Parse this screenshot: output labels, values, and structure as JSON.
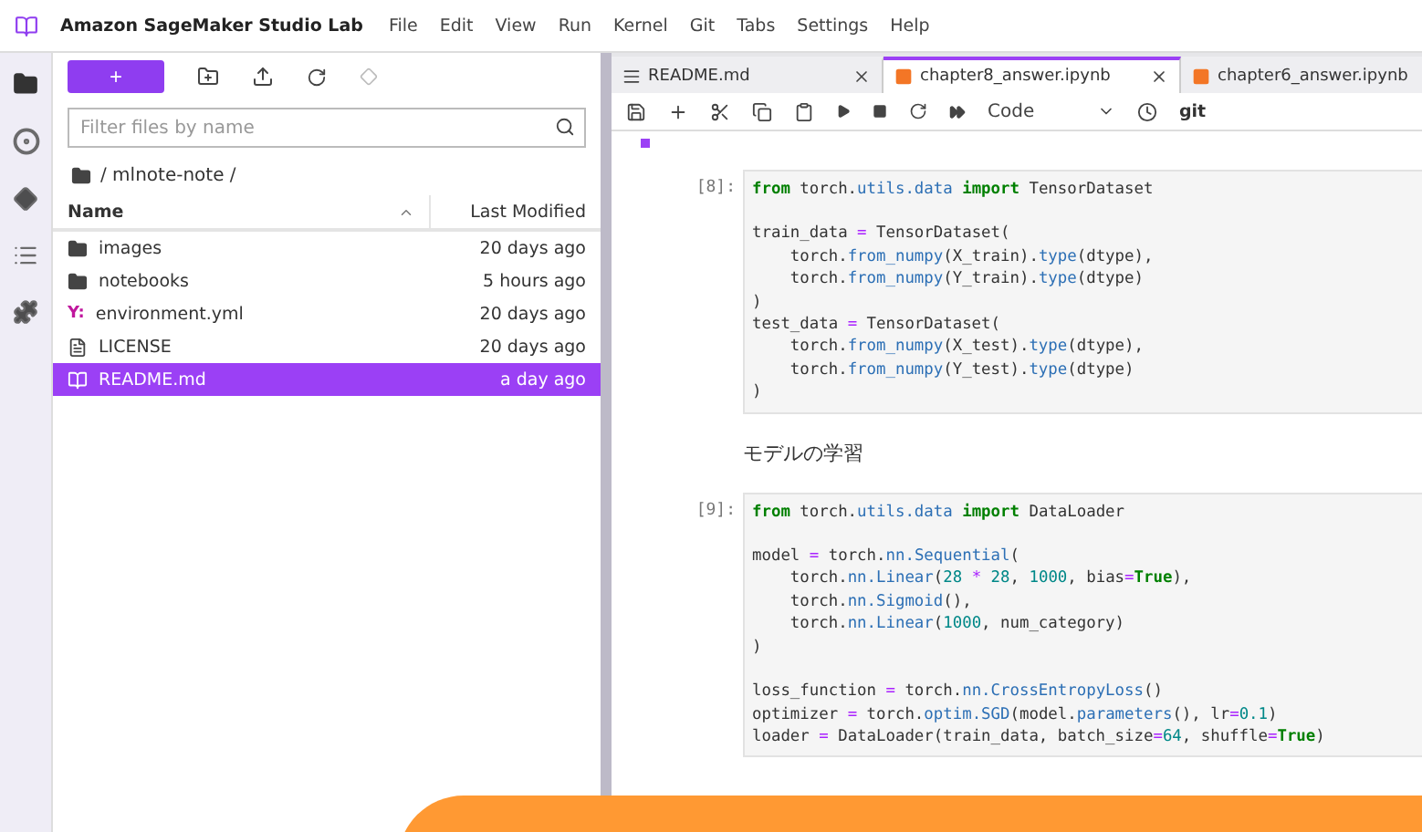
{
  "app_title": "Amazon SageMaker Studio Lab",
  "menu": [
    "File",
    "Edit",
    "View",
    "Run",
    "Kernel",
    "Git",
    "Tabs",
    "Settings",
    "Help"
  ],
  "activity_bar": [
    {
      "kind": "folder",
      "selected": true
    },
    {
      "kind": "running",
      "selected": false
    },
    {
      "kind": "git",
      "selected": false
    },
    {
      "kind": "toc",
      "selected": false
    },
    {
      "kind": "extensions",
      "selected": false
    }
  ],
  "file_browser": {
    "new_button": "+",
    "search": {
      "placeholder": "Filter files by name"
    },
    "path": "/ mlnote-note /",
    "columns": [
      "Name",
      "Last Modified"
    ],
    "files": [
      {
        "kind": "folder",
        "name": "images",
        "modified": "20 days ago",
        "selected": false
      },
      {
        "kind": "folder",
        "name": "notebooks",
        "modified": "5 hours ago",
        "selected": false
      },
      {
        "kind": "yaml",
        "badge": "Y:",
        "name": "environment.yml",
        "modified": "20 days ago",
        "selected": false
      },
      {
        "kind": "file",
        "name": "LICENSE",
        "modified": "20 days ago",
        "selected": false
      },
      {
        "kind": "markdown",
        "name": "README.md",
        "modified": "a day ago",
        "selected": true
      }
    ]
  },
  "tabs": [
    {
      "kind": "markdown",
      "label": "README.md",
      "selected": false
    },
    {
      "kind": "notebook",
      "label": "chapter8_answer.ipynb",
      "selected": true
    },
    {
      "kind": "notebook",
      "label": "chapter6_answer.ipynb",
      "selected": false
    }
  ],
  "toolbar": {
    "cell_type": "Code",
    "git": "git"
  },
  "cells": [
    {
      "kind": "code",
      "prompt": "[8]:",
      "blocks": [
        [
          [
            {
              "kind": "keyword",
              "text": "from"
            },
            {
              "kind": "plain",
              "text": " torch."
            },
            {
              "kind": "name",
              "text": "utils.data"
            },
            {
              "kind": "keyword",
              "text": " import"
            },
            {
              "kind": "plain",
              "text": " TensorDataset"
            }
          ]
        ],
        [
          [
            {
              "kind": "plain",
              "text": "train_data "
            },
            {
              "kind": "operator",
              "text": "="
            },
            {
              "kind": "plain",
              "text": " TensorDataset("
            }
          ],
          [
            {
              "kind": "plain",
              "text": "    torch."
            },
            {
              "kind": "name",
              "text": "from_numpy"
            },
            {
              "kind": "plain",
              "text": "(X_train)."
            },
            {
              "kind": "name",
              "text": "type"
            },
            {
              "kind": "plain",
              "text": "(dtype),"
            }
          ],
          [
            {
              "kind": "plain",
              "text": "    torch."
            },
            {
              "kind": "name",
              "text": "from_numpy"
            },
            {
              "kind": "plain",
              "text": "(Y_train)."
            },
            {
              "kind": "name",
              "text": "type"
            },
            {
              "kind": "plain",
              "text": "(dtype)"
            }
          ],
          [
            {
              "kind": "plain",
              "text": ")"
            }
          ],
          [
            {
              "kind": "plain",
              "text": "test_data "
            },
            {
              "kind": "operator",
              "text": "="
            },
            {
              "kind": "plain",
              "text": " TensorDataset("
            }
          ],
          [
            {
              "kind": "plain",
              "text": "    torch."
            },
            {
              "kind": "name",
              "text": "from_numpy"
            },
            {
              "kind": "plain",
              "text": "(X_test)."
            },
            {
              "kind": "name",
              "text": "type"
            },
            {
              "kind": "plain",
              "text": "(dtype),"
            }
          ],
          [
            {
              "kind": "plain",
              "text": "    torch."
            },
            {
              "kind": "name",
              "text": "from_numpy"
            },
            {
              "kind": "plain",
              "text": "(Y_test)."
            },
            {
              "kind": "name",
              "text": "type"
            },
            {
              "kind": "plain",
              "text": "(dtype)"
            }
          ],
          [
            {
              "kind": "plain",
              "text": ")"
            }
          ]
        ]
      ]
    },
    {
      "kind": "markdown",
      "text": "モデルの学習"
    },
    {
      "kind": "code",
      "prompt": "[9]:",
      "blocks": [
        [
          [
            {
              "kind": "keyword",
              "text": "from"
            },
            {
              "kind": "plain",
              "text": " torch."
            },
            {
              "kind": "name",
              "text": "utils.data"
            },
            {
              "kind": "keyword",
              "text": " import"
            },
            {
              "kind": "plain",
              "text": " DataLoader"
            }
          ]
        ],
        [
          [
            {
              "kind": "plain",
              "text": "model "
            },
            {
              "kind": "operator",
              "text": "="
            },
            {
              "kind": "plain",
              "text": " torch."
            },
            {
              "kind": "name",
              "text": "nn.Sequential"
            },
            {
              "kind": "plain",
              "text": "("
            }
          ],
          [
            {
              "kind": "plain",
              "text": "    torch."
            },
            {
              "kind": "name",
              "text": "nn.Linear"
            },
            {
              "kind": "plain",
              "text": "("
            },
            {
              "kind": "number",
              "text": "28"
            },
            {
              "kind": "operator",
              "text": " * "
            },
            {
              "kind": "number",
              "text": "28"
            },
            {
              "kind": "plain",
              "text": ", "
            },
            {
              "kind": "number",
              "text": "1000"
            },
            {
              "kind": "plain",
              "text": ", bias"
            },
            {
              "kind": "operator",
              "text": "="
            },
            {
              "kind": "keyword",
              "text": "True"
            },
            {
              "kind": "plain",
              "text": "),"
            }
          ],
          [
            {
              "kind": "plain",
              "text": "    torch."
            },
            {
              "kind": "name",
              "text": "nn.Sigmoid"
            },
            {
              "kind": "plain",
              "text": "(),"
            }
          ],
          [
            {
              "kind": "plain",
              "text": "    torch."
            },
            {
              "kind": "name",
              "text": "nn.Linear"
            },
            {
              "kind": "plain",
              "text": "("
            },
            {
              "kind": "number",
              "text": "1000"
            },
            {
              "kind": "plain",
              "text": ", num_category)"
            }
          ],
          [
            {
              "kind": "plain",
              "text": ")"
            }
          ]
        ],
        [
          [
            {
              "kind": "plain",
              "text": "loss_function "
            },
            {
              "kind": "operator",
              "text": "="
            },
            {
              "kind": "plain",
              "text": " torch."
            },
            {
              "kind": "name",
              "text": "nn.CrossEntropyLoss"
            },
            {
              "kind": "plain",
              "text": "()"
            }
          ],
          [
            {
              "kind": "plain",
              "text": "optimizer "
            },
            {
              "kind": "operator",
              "text": "="
            },
            {
              "kind": "plain",
              "text": " torch."
            },
            {
              "kind": "name",
              "text": "optim.SGD"
            },
            {
              "kind": "plain",
              "text": "(model."
            },
            {
              "kind": "name",
              "text": "parameters"
            },
            {
              "kind": "plain",
              "text": "(), lr"
            },
            {
              "kind": "operator",
              "text": "="
            },
            {
              "kind": "number",
              "text": "0.1"
            },
            {
              "kind": "plain",
              "text": ")"
            }
          ],
          [
            {
              "kind": "plain",
              "text": "loader "
            },
            {
              "kind": "operator",
              "text": "="
            },
            {
              "kind": "plain",
              "text": " DataLoader(train_data, batch_size"
            },
            {
              "kind": "operator",
              "text": "="
            },
            {
              "kind": "number",
              "text": "64"
            },
            {
              "kind": "plain",
              "text": ", shuffle"
            },
            {
              "kind": "operator",
              "text": "="
            },
            {
              "kind": "keyword",
              "text": "True"
            },
            {
              "kind": "plain",
              "text": ")"
            }
          ]
        ]
      ]
    }
  ]
}
